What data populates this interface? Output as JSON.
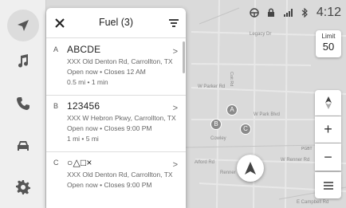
{
  "map": {
    "labels": [
      {
        "text": "Legacy Dr"
      },
      {
        "text": "W Parker Rd"
      },
      {
        "text": "W Park Blvd"
      },
      {
        "text": "Coit Rd"
      },
      {
        "text": "Cowley"
      },
      {
        "text": "Alford Rd"
      },
      {
        "text": "Renner"
      },
      {
        "text": "W Renner Rd"
      },
      {
        "text": "E Campbell Rd"
      },
      {
        "text": "PGBT"
      }
    ],
    "pins": [
      "A",
      "B",
      "C"
    ]
  },
  "rail": {
    "items": [
      {
        "icon": "navigation-arrow-icon"
      },
      {
        "icon": "music-note-icon"
      },
      {
        "icon": "phone-icon"
      },
      {
        "icon": "car-icon"
      },
      {
        "icon": "gear-icon"
      }
    ]
  },
  "panel": {
    "title": "Fuel (3)",
    "results": [
      {
        "letter": "A",
        "name": "ABCDE",
        "address": "XXX Old Denton Rd, Carrollton, TX",
        "hours": "Open now  • Closes 12 AM",
        "distance": "0.5 mi  • 1 min"
      },
      {
        "letter": "B",
        "name": "123456",
        "address": "XXX W Hebron Pkwy, Carrollton, TX",
        "hours": "Open now  • Closes 9:00 PM",
        "distance": "1 mi   • 5 mi"
      },
      {
        "letter": "C",
        "name": "○△□×",
        "address": "XXX Old Denton Rd, Carrollton, TX",
        "hours": "Open now  • Closes 9:00 PM",
        "distance": ""
      }
    ]
  },
  "status": {
    "time": "4:12"
  },
  "speed_limit": {
    "label": "Limit",
    "value": "50"
  },
  "controls": {
    "zoom_in": "+",
    "zoom_out": "−"
  }
}
